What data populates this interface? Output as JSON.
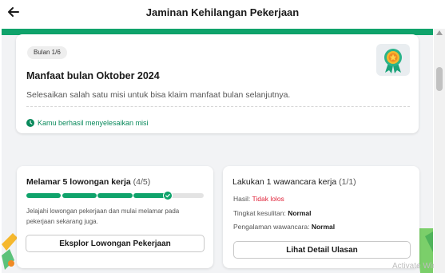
{
  "header": {
    "title": "Jaminan Kehilangan Pekerjaan",
    "back_icon": "arrow-left-icon"
  },
  "summary_card": {
    "badge": "Bulan 1/6",
    "title": "Manfaat bulan Oktober 2024",
    "description": "Selesaikan salah satu misi untuk bisa klaim manfaat bulan selanjutnya.",
    "success_icon": "clock-icon",
    "success_text": "Kamu berhasil menyelesaikan misi",
    "medal_icon": "medal-icon"
  },
  "mission_apply": {
    "title": "Melamar 5 lowongan kerja",
    "count": "(4/5)",
    "progress_done": 4,
    "progress_total": 5,
    "description": "Jelajahi lowongan pekerjaan dan mulai melamar pada pekerjaan sekarang juga.",
    "button_label": "Eksplor Lowongan Pekerjaan"
  },
  "mission_interview": {
    "title": "Lakukan 1 wawancara kerja",
    "count": "(1/1)",
    "result_label": "Hasil:",
    "result_value": "Tidak lolos",
    "difficulty_label": "Tingkat kesulitan:",
    "difficulty_value": "Normal",
    "experience_label": "Pengalaman wawancara:",
    "experience_value": "Normal",
    "button_label": "Lihat Detail Ulasan"
  },
  "watermark": "Activate Windows",
  "colors": {
    "brand_green": "#0fa36b",
    "error_red": "#e0243a"
  }
}
